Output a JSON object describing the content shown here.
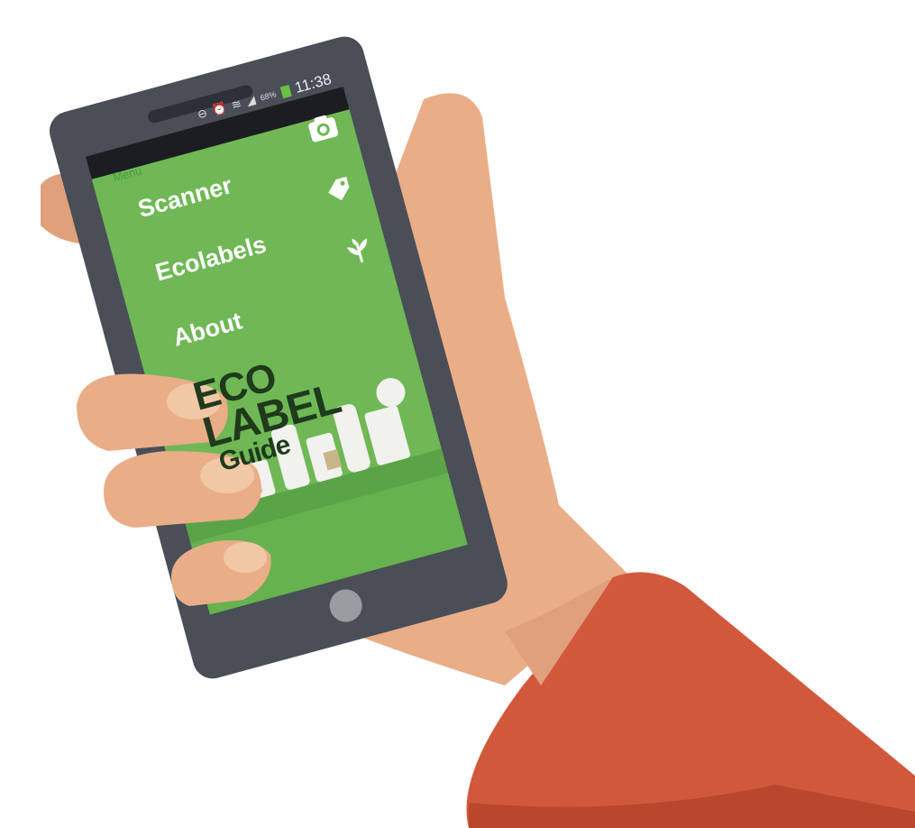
{
  "status_bar": {
    "battery_percent": "68%",
    "time": "11:38",
    "icons": [
      "vibrate-icon",
      "alarm-icon",
      "wifi-icon",
      "signal-icon",
      "battery-icon"
    ]
  },
  "menu": {
    "header": "Menu",
    "items": [
      {
        "label": "Scanner",
        "icon": "camera-icon"
      },
      {
        "label": "Ecolabels",
        "icon": "tag-icon"
      },
      {
        "label": "About",
        "icon": "leaf-icon"
      }
    ]
  },
  "logo": {
    "line1": "ECO",
    "line2": "LABEL",
    "line3": "Guide"
  },
  "colors": {
    "screen_green": "#6fb855",
    "phone_body": "#4a4e57",
    "skin": "#e9ad87",
    "sleeve": "#d2583c"
  }
}
